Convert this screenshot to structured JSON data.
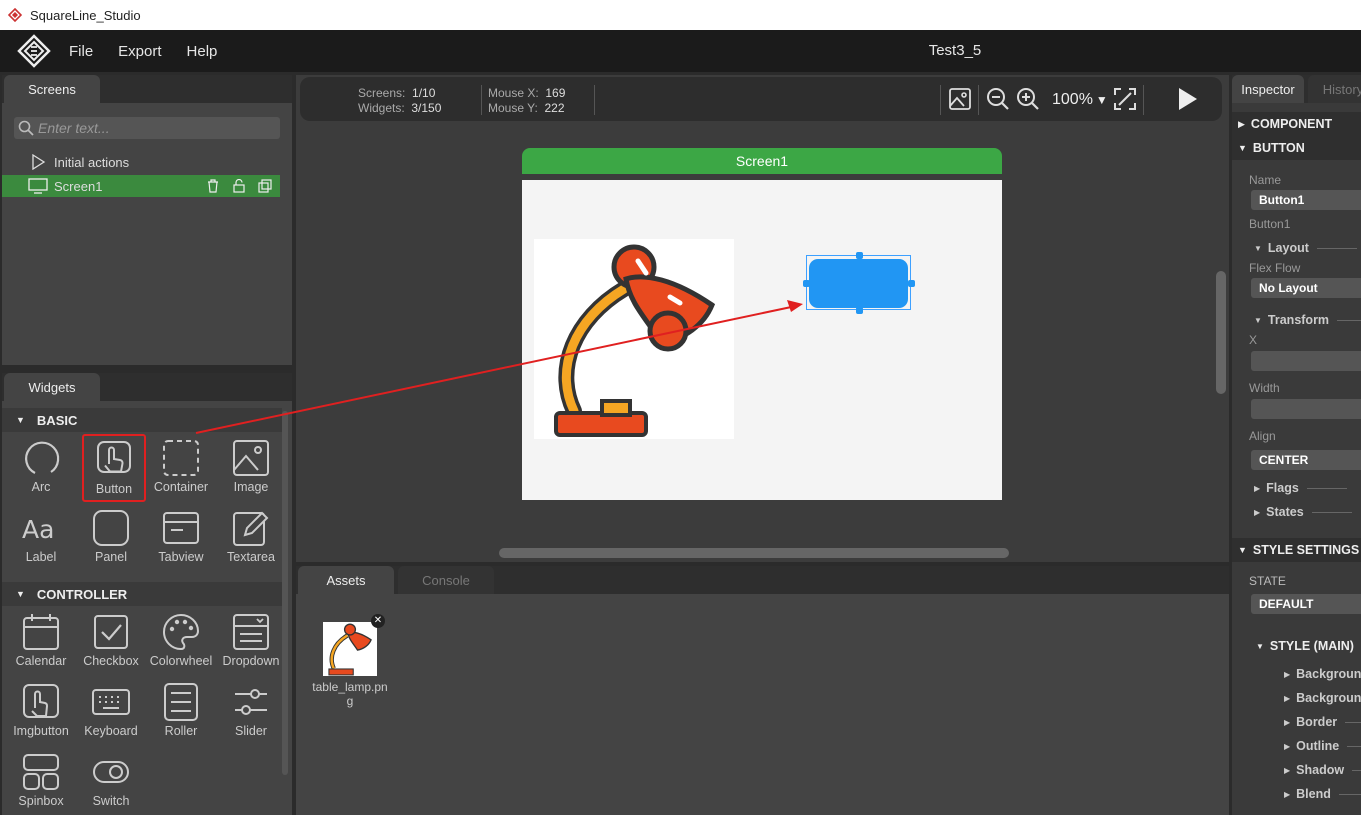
{
  "os_window": {
    "title": "SquareLine_Studio"
  },
  "menu": {
    "items": [
      "File",
      "Export",
      "Help"
    ],
    "doc_title": "Test3_5"
  },
  "screens_panel": {
    "tab_label": "Screens",
    "search_placeholder": "Enter text...",
    "tree": [
      {
        "label": "Initial actions",
        "icon": "play-icon"
      },
      {
        "label": "Screen1",
        "icon": "monitor-icon",
        "selected": true
      }
    ]
  },
  "widgets_panel": {
    "tab_label": "Widgets",
    "sections": [
      {
        "title": "BASIC",
        "items": [
          "Arc",
          "Button",
          "Container",
          "Image",
          "Label",
          "Panel",
          "Tabview",
          "Textarea"
        ]
      },
      {
        "title": "CONTROLLER",
        "items": [
          "Calendar",
          "Checkbox",
          "Colorwheel",
          "Dropdown",
          "Imgbutton",
          "Keyboard",
          "Roller",
          "Slider",
          "Spinbox",
          "Switch"
        ]
      }
    ]
  },
  "canvas": {
    "stats": {
      "screens_label": "Screens:",
      "screens_value": "1/10",
      "widgets_label": "Widgets:",
      "widgets_value": "3/150",
      "mouse_x_label": "Mouse X:",
      "mouse_x_value": "169",
      "mouse_y_label": "Mouse Y:",
      "mouse_y_value": "222"
    },
    "zoom_label": "100%",
    "screen_title": "Screen1"
  },
  "bottom_panel": {
    "tabs": [
      "Assets",
      "Console"
    ],
    "assets": [
      {
        "name": "table_lamp.png"
      }
    ]
  },
  "inspector": {
    "tabs": [
      "Inspector",
      "History"
    ],
    "sections": {
      "component": "COMPONENT",
      "button": "BUTTON",
      "style_settings": "STYLE SETTINGS",
      "style_main": "STYLE (MAIN)"
    },
    "name_label": "Name",
    "name_value": "Button1",
    "name_caption": "Button1",
    "layout_label": "Layout",
    "flex_flow_label": "Flex Flow",
    "flex_flow_value": "No Layout",
    "transform_label": "Transform",
    "x_label": "X",
    "width_label": "Width",
    "align_label": "Align",
    "align_value": "CENTER",
    "flags_label": "Flags",
    "states_label": "States",
    "state_label": "STATE",
    "state_value": "DEFAULT",
    "style_items": [
      "Background",
      "Background",
      "Border",
      "Outline",
      "Shadow",
      "Blend"
    ]
  },
  "colors": {
    "accent_green": "#3ca745",
    "selection_blue": "#2196f3",
    "highlight_red": "#e02020"
  }
}
